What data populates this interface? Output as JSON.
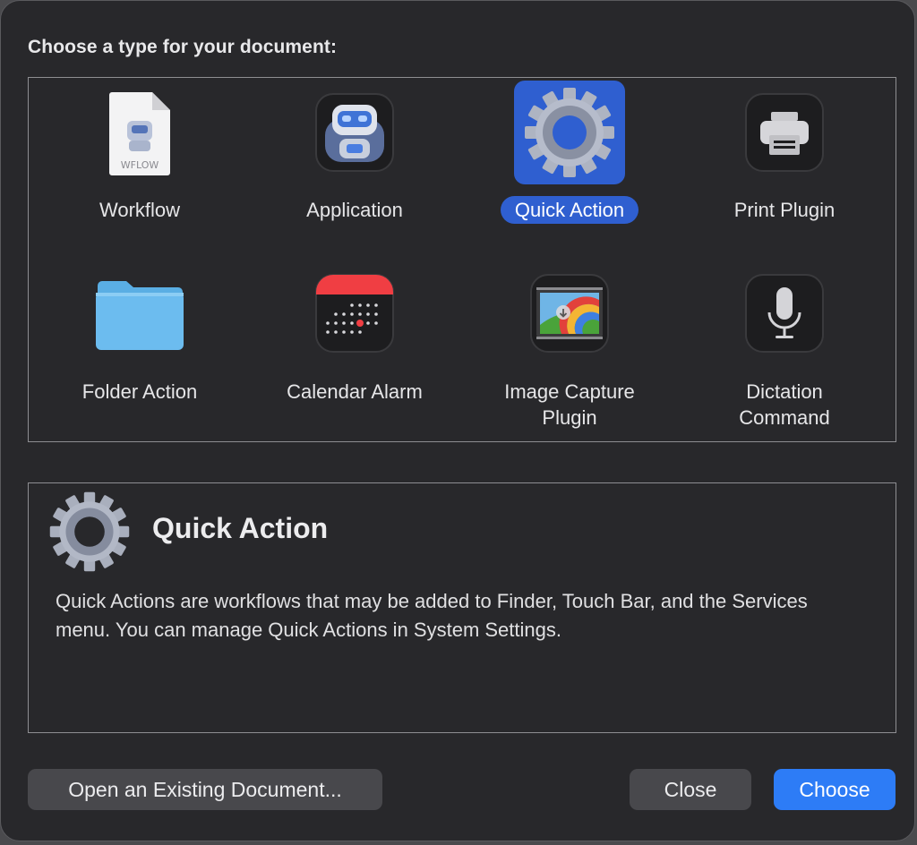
{
  "heading": "Choose a type for your document:",
  "types": [
    {
      "label": "Workflow",
      "icon": "workflow-document-icon",
      "selected": false
    },
    {
      "label": "Application",
      "icon": "automator-robot-icon",
      "selected": false
    },
    {
      "label": "Quick Action",
      "icon": "gear-icon",
      "selected": true
    },
    {
      "label": "Print Plugin",
      "icon": "printer-icon",
      "selected": false
    },
    {
      "label": "Folder Action",
      "icon": "folder-icon",
      "selected": false
    },
    {
      "label": "Calendar Alarm",
      "icon": "calendar-icon",
      "selected": false
    },
    {
      "label": "Image Capture Plugin",
      "icon": "image-capture-icon",
      "selected": false
    },
    {
      "label": "Dictation Command",
      "icon": "microphone-icon",
      "selected": false
    }
  ],
  "workflow_badge": "WFLOW",
  "description": {
    "title": "Quick Action",
    "icon": "gear-icon",
    "text": "Quick Actions are workflows that may be added to Finder, Touch Bar, and the Services menu. You can manage Quick Actions in System Settings."
  },
  "buttons": {
    "open_existing": "Open an Existing Document...",
    "close": "Close",
    "choose": "Choose"
  },
  "colors": {
    "accent": "#2d7cf6",
    "selection": "#2f5fd0",
    "window_bg": "#28282b"
  }
}
